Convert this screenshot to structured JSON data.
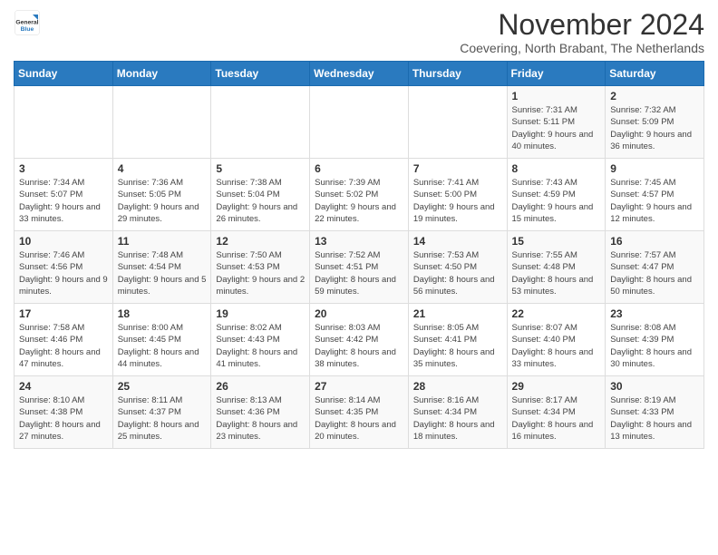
{
  "header": {
    "logo_general": "General",
    "logo_blue": "Blue",
    "title": "November 2024",
    "subtitle": "Coevering, North Brabant, The Netherlands"
  },
  "days_of_week": [
    "Sunday",
    "Monday",
    "Tuesday",
    "Wednesday",
    "Thursday",
    "Friday",
    "Saturday"
  ],
  "weeks": [
    [
      {
        "day": "",
        "info": ""
      },
      {
        "day": "",
        "info": ""
      },
      {
        "day": "",
        "info": ""
      },
      {
        "day": "",
        "info": ""
      },
      {
        "day": "",
        "info": ""
      },
      {
        "day": "1",
        "info": "Sunrise: 7:31 AM\nSunset: 5:11 PM\nDaylight: 9 hours and 40 minutes."
      },
      {
        "day": "2",
        "info": "Sunrise: 7:32 AM\nSunset: 5:09 PM\nDaylight: 9 hours and 36 minutes."
      }
    ],
    [
      {
        "day": "3",
        "info": "Sunrise: 7:34 AM\nSunset: 5:07 PM\nDaylight: 9 hours and 33 minutes."
      },
      {
        "day": "4",
        "info": "Sunrise: 7:36 AM\nSunset: 5:05 PM\nDaylight: 9 hours and 29 minutes."
      },
      {
        "day": "5",
        "info": "Sunrise: 7:38 AM\nSunset: 5:04 PM\nDaylight: 9 hours and 26 minutes."
      },
      {
        "day": "6",
        "info": "Sunrise: 7:39 AM\nSunset: 5:02 PM\nDaylight: 9 hours and 22 minutes."
      },
      {
        "day": "7",
        "info": "Sunrise: 7:41 AM\nSunset: 5:00 PM\nDaylight: 9 hours and 19 minutes."
      },
      {
        "day": "8",
        "info": "Sunrise: 7:43 AM\nSunset: 4:59 PM\nDaylight: 9 hours and 15 minutes."
      },
      {
        "day": "9",
        "info": "Sunrise: 7:45 AM\nSunset: 4:57 PM\nDaylight: 9 hours and 12 minutes."
      }
    ],
    [
      {
        "day": "10",
        "info": "Sunrise: 7:46 AM\nSunset: 4:56 PM\nDaylight: 9 hours and 9 minutes."
      },
      {
        "day": "11",
        "info": "Sunrise: 7:48 AM\nSunset: 4:54 PM\nDaylight: 9 hours and 5 minutes."
      },
      {
        "day": "12",
        "info": "Sunrise: 7:50 AM\nSunset: 4:53 PM\nDaylight: 9 hours and 2 minutes."
      },
      {
        "day": "13",
        "info": "Sunrise: 7:52 AM\nSunset: 4:51 PM\nDaylight: 8 hours and 59 minutes."
      },
      {
        "day": "14",
        "info": "Sunrise: 7:53 AM\nSunset: 4:50 PM\nDaylight: 8 hours and 56 minutes."
      },
      {
        "day": "15",
        "info": "Sunrise: 7:55 AM\nSunset: 4:48 PM\nDaylight: 8 hours and 53 minutes."
      },
      {
        "day": "16",
        "info": "Sunrise: 7:57 AM\nSunset: 4:47 PM\nDaylight: 8 hours and 50 minutes."
      }
    ],
    [
      {
        "day": "17",
        "info": "Sunrise: 7:58 AM\nSunset: 4:46 PM\nDaylight: 8 hours and 47 minutes."
      },
      {
        "day": "18",
        "info": "Sunrise: 8:00 AM\nSunset: 4:45 PM\nDaylight: 8 hours and 44 minutes."
      },
      {
        "day": "19",
        "info": "Sunrise: 8:02 AM\nSunset: 4:43 PM\nDaylight: 8 hours and 41 minutes."
      },
      {
        "day": "20",
        "info": "Sunrise: 8:03 AM\nSunset: 4:42 PM\nDaylight: 8 hours and 38 minutes."
      },
      {
        "day": "21",
        "info": "Sunrise: 8:05 AM\nSunset: 4:41 PM\nDaylight: 8 hours and 35 minutes."
      },
      {
        "day": "22",
        "info": "Sunrise: 8:07 AM\nSunset: 4:40 PM\nDaylight: 8 hours and 33 minutes."
      },
      {
        "day": "23",
        "info": "Sunrise: 8:08 AM\nSunset: 4:39 PM\nDaylight: 8 hours and 30 minutes."
      }
    ],
    [
      {
        "day": "24",
        "info": "Sunrise: 8:10 AM\nSunset: 4:38 PM\nDaylight: 8 hours and 27 minutes."
      },
      {
        "day": "25",
        "info": "Sunrise: 8:11 AM\nSunset: 4:37 PM\nDaylight: 8 hours and 25 minutes."
      },
      {
        "day": "26",
        "info": "Sunrise: 8:13 AM\nSunset: 4:36 PM\nDaylight: 8 hours and 23 minutes."
      },
      {
        "day": "27",
        "info": "Sunrise: 8:14 AM\nSunset: 4:35 PM\nDaylight: 8 hours and 20 minutes."
      },
      {
        "day": "28",
        "info": "Sunrise: 8:16 AM\nSunset: 4:34 PM\nDaylight: 8 hours and 18 minutes."
      },
      {
        "day": "29",
        "info": "Sunrise: 8:17 AM\nSunset: 4:34 PM\nDaylight: 8 hours and 16 minutes."
      },
      {
        "day": "30",
        "info": "Sunrise: 8:19 AM\nSunset: 4:33 PM\nDaylight: 8 hours and 13 minutes."
      }
    ]
  ]
}
